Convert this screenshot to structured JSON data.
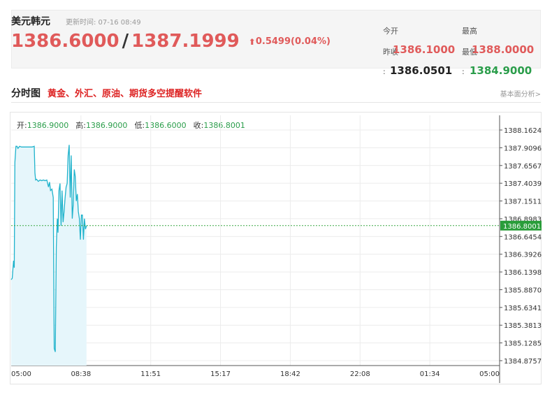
{
  "header": {
    "pair_name": "美元韩元",
    "update_label": "更新时间: 07-16 08:49",
    "bid": "1386.6000",
    "separator": "/",
    "ask": "1387.1999",
    "change_arrow": "⬆",
    "change": "0.5499(0.04%)",
    "open_label": "今开",
    "open_value": "1386.1000",
    "prev_close_label": "昨收",
    "prev_close_value": "1386.0501",
    "high_label": "最高",
    "high_value": "1388.0000",
    "low_label": "最低",
    "low_value": "1384.9000",
    "colon": ":"
  },
  "section": {
    "title": "分时图",
    "ad_text": "黄金、外汇、原油、期货多空提醒软件",
    "link_text": "基本面分析>"
  },
  "ohlc": {
    "open_label": "开:",
    "open_value": "1386.9000",
    "high_label": "高:",
    "high_value": "1386.9000",
    "low_label": "低:",
    "low_value": "1386.6000",
    "close_label": "收:",
    "close_value": "1386.8001"
  },
  "chart_data": {
    "type": "area",
    "x_ticks": [
      "05:00",
      "08:38",
      "11:51",
      "15:17",
      "18:42",
      "22:08",
      "01:34",
      "05:00"
    ],
    "y_ticks": [
      1388.1624,
      1387.9096,
      1387.6567,
      1387.4039,
      1387.1511,
      1386.8983,
      1386.6454,
      1386.3926,
      1386.1398,
      1385.887,
      1385.6341,
      1385.3813,
      1385.1285,
      1384.8757
    ],
    "y_tick_labels": [
      "1388.1624",
      "1387.9096",
      "1387.6567",
      "1387.4039",
      "1387.1511",
      "1386.8983",
      "1386.6454",
      "1386.3926",
      "1386.1398",
      "1385.8870",
      "1385.6341",
      "1385.3813",
      "1385.1285",
      "1384.8757"
    ],
    "ylim": [
      1384.8757,
      1388.1624
    ],
    "x_range_minutes": [
      0,
      1440
    ],
    "reference_value": 1386.8001,
    "reference_label": "1386.8001",
    "series": [
      {
        "x": [
          0,
          3,
          7,
          9,
          11,
          14,
          17,
          20,
          25,
          30,
          40,
          50,
          62,
          68,
          70,
          72,
          75,
          80,
          85,
          90,
          95,
          100,
          105,
          110,
          113,
          116,
          120,
          124,
          127,
          130,
          133,
          136,
          138,
          141,
          144,
          147,
          150,
          153,
          156,
          159,
          162,
          165,
          168,
          171,
          174,
          177,
          180,
          183,
          186,
          189,
          192,
          195,
          198,
          201,
          204,
          207,
          210,
          213,
          216,
          219,
          222
        ],
        "y": [
          1386.03,
          1386.05,
          1386.3,
          1386.2,
          1387.7,
          1387.93,
          1387.93,
          1387.9,
          1387.93,
          1387.92,
          1387.92,
          1387.92,
          1387.92,
          1387.93,
          1387.55,
          1387.45,
          1387.46,
          1387.43,
          1387.45,
          1387.44,
          1387.45,
          1387.44,
          1387.45,
          1387.35,
          1387.42,
          1387.3,
          1387.32,
          1387.2,
          1385.05,
          1385.0,
          1386.5,
          1386.9,
          1386.7,
          1387.3,
          1387.4,
          1386.8,
          1387.3,
          1386.85,
          1387.0,
          1387.2,
          1387.35,
          1387.4,
          1387.8,
          1387.95,
          1387.2,
          1387.8,
          1386.9,
          1387.1,
          1387.6,
          1387.5,
          1387.15,
          1387.25,
          1387.0,
          1386.9,
          1386.6,
          1386.95,
          1386.95,
          1386.6,
          1386.9,
          1386.75,
          1386.8
        ]
      }
    ]
  }
}
